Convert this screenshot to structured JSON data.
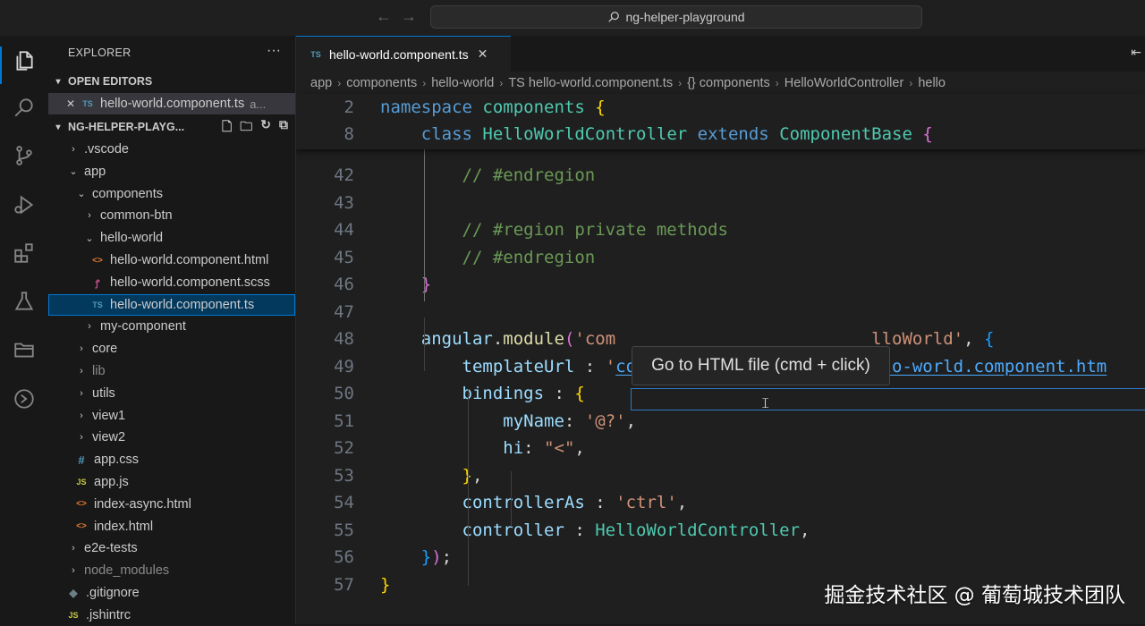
{
  "titlebar": {
    "search_text": "ng-helper-playground",
    "back_icon": "←",
    "forward_icon": "→"
  },
  "activity_bar": [
    "explorer-icon",
    "search-icon",
    "source-control-icon",
    "run-debug-icon",
    "extensions-icon",
    "testing-icon",
    "folder-icon",
    "remote-icon"
  ],
  "sidebar": {
    "title": "EXPLORER",
    "more": "···",
    "open_editors": {
      "label": "OPEN EDITORS",
      "items": [
        {
          "close": "✕",
          "icon": "TS",
          "name": "hello-world.component.ts",
          "path": "a..."
        }
      ]
    },
    "workspace": {
      "label": "NG-HELPER-PLAYG...",
      "tree": [
        {
          "name": ".vscode",
          "type": "folder",
          "open": false,
          "depth": 1
        },
        {
          "name": "app",
          "type": "folder",
          "open": true,
          "depth": 1
        },
        {
          "name": "components",
          "type": "folder",
          "open": true,
          "depth": 2
        },
        {
          "name": "common-btn",
          "type": "folder",
          "open": false,
          "depth": 3
        },
        {
          "name": "hello-world",
          "type": "folder",
          "open": true,
          "depth": 3
        },
        {
          "name": "hello-world.component.html",
          "type": "html",
          "depth": 4
        },
        {
          "name": "hello-world.component.scss",
          "type": "scss",
          "depth": 4
        },
        {
          "name": "hello-world.component.ts",
          "type": "ts",
          "depth": 4,
          "selected": true
        },
        {
          "name": "my-component",
          "type": "folder",
          "open": false,
          "depth": 3
        },
        {
          "name": "core",
          "type": "folder",
          "open": false,
          "depth": 2
        },
        {
          "name": "lib",
          "type": "folder",
          "open": false,
          "depth": 2,
          "dim": true
        },
        {
          "name": "utils",
          "type": "folder",
          "open": false,
          "depth": 2
        },
        {
          "name": "view1",
          "type": "folder",
          "open": false,
          "depth": 2
        },
        {
          "name": "view2",
          "type": "folder",
          "open": false,
          "depth": 2
        },
        {
          "name": "app.css",
          "type": "css",
          "depth": 2
        },
        {
          "name": "app.js",
          "type": "js",
          "depth": 2
        },
        {
          "name": "index-async.html",
          "type": "html",
          "depth": 2
        },
        {
          "name": "index.html",
          "type": "html",
          "depth": 2
        },
        {
          "name": "e2e-tests",
          "type": "folder",
          "open": false,
          "depth": 1
        },
        {
          "name": "node_modules",
          "type": "folder",
          "open": false,
          "depth": 1,
          "dim": true
        },
        {
          "name": ".gitignore",
          "type": "git",
          "depth": 1
        },
        {
          "name": ".jshintrc",
          "type": "js",
          "depth": 1
        }
      ]
    }
  },
  "editor": {
    "tab": {
      "icon": "TS",
      "label": "hello-world.component.ts",
      "close": "✕"
    },
    "breadcrumbs": [
      "app",
      "components",
      "hello-world",
      "TS hello-world.component.ts",
      "{} components",
      "HelloWorldController",
      "hello"
    ],
    "sticky": [
      {
        "n": "2",
        "html": "<span class='kw'>namespace</span> <span class='ty'>components</span> <span class='br1'>{</span>"
      },
      {
        "n": "8",
        "html": "    <span class='kw'>class</span> <span class='ty'>HelloWorldController</span> <span class='kw'>extends</span> <span class='ty'>ComponentBase</span> <span class='br2'>{</span>"
      }
    ],
    "lines": [
      {
        "n": "42",
        "html": "        <span class='cm'>// #endregion</span>"
      },
      {
        "n": "43",
        "html": ""
      },
      {
        "n": "44",
        "html": "        <span class='cm'>// #region private methods</span>"
      },
      {
        "n": "45",
        "html": "        <span class='cm'>// #endregion</span>"
      },
      {
        "n": "46",
        "html": "    <span class='br2'>}</span>"
      },
      {
        "n": "47",
        "html": ""
      },
      {
        "n": "48",
        "html": "    <span class='pr'>angular</span>.<span class='fn'>module</span><span class='br2'>(</span><span class='str'>'com</span>                         <span class='str'>lloWorld'</span>, <span class='br3'>{</span>"
      },
      {
        "n": "49",
        "html": "        <span class='pr'>templateUrl</span> : <span class='str'>'</span><span class='link'>components/hello-world/hello-world.component.htm</span>"
      },
      {
        "n": "50",
        "html": "        <span class='pr'>bindings</span> : <span class='br1'>{</span>"
      },
      {
        "n": "51",
        "html": "            <span class='pr'>myName</span>: <span class='str'>'@?'</span>,"
      },
      {
        "n": "52",
        "html": "            <span class='pr'>hi</span>: <span class='str'>\"&lt;\"</span>,"
      },
      {
        "n": "53",
        "html": "        <span class='br1'>}</span>,"
      },
      {
        "n": "54",
        "html": "        <span class='pr'>controllerAs</span> : <span class='str'>'ctrl'</span>,"
      },
      {
        "n": "55",
        "html": "        <span class='pr'>controller</span> : <span class='ty'>HelloWorldController</span>,"
      },
      {
        "n": "56",
        "html": "    <span class='br3'>}</span><span class='br2'>)</span>;"
      },
      {
        "n": "57",
        "html": "<span class='br1'>}</span>"
      }
    ],
    "hover_tooltip": "Go to HTML file (cmd + click)"
  },
  "watermark": "掘金技术社区 @ 葡萄城技术团队"
}
